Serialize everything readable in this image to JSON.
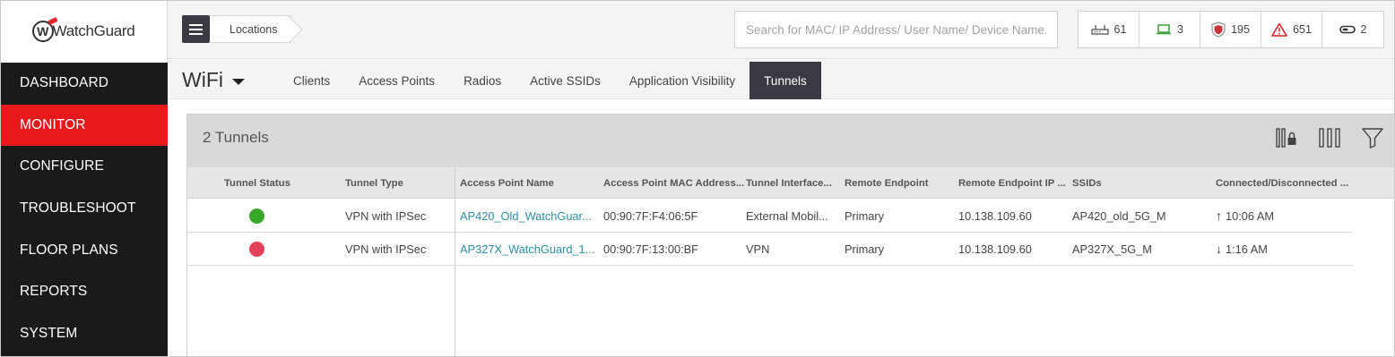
{
  "brand": {
    "logo_text": "WatchGuard"
  },
  "nav": {
    "items": [
      {
        "label": "DASHBOARD"
      },
      {
        "label": "MONITOR"
      },
      {
        "label": "CONFIGURE"
      },
      {
        "label": "TROUBLESHOOT"
      },
      {
        "label": "FLOOR PLANS"
      },
      {
        "label": "REPORTS"
      },
      {
        "label": "SYSTEM"
      }
    ],
    "active": "MONITOR"
  },
  "topbar": {
    "breadcrumb": "Locations",
    "search_placeholder": "Search for MAC/ IP Address/ User Name/ Device Name.",
    "counters": [
      {
        "icon": "access-point-icon",
        "value": "61",
        "color": "#555555"
      },
      {
        "icon": "laptop-icon",
        "value": "3",
        "color": "#3aa035"
      },
      {
        "icon": "shield-icon",
        "value": "195",
        "color": "#c8333a"
      },
      {
        "icon": "warning-triangle-icon",
        "value": "651",
        "color": "#d0201f"
      },
      {
        "icon": "sensor-icon",
        "value": "2",
        "color": "#333333"
      }
    ]
  },
  "section": {
    "title": "WiFi",
    "tabs": [
      {
        "label": "Clients"
      },
      {
        "label": "Access Points"
      },
      {
        "label": "Radios"
      },
      {
        "label": "Active SSIDs"
      },
      {
        "label": "Application Visibility"
      },
      {
        "label": "Tunnels"
      }
    ],
    "active_tab": "Tunnels"
  },
  "panel": {
    "title": "2 Tunnels",
    "tools": [
      "column-lock-icon",
      "columns-icon",
      "filter-icon"
    ]
  },
  "table": {
    "columns": [
      "Tunnel Status",
      "Tunnel Type",
      "Access Point Name",
      "Access Point MAC Address...",
      "Tunnel Interface...",
      "Remote Endpoint",
      "Remote Endpoint IP ...",
      "SSIDs",
      "Connected/Disconnected ..."
    ],
    "rows": [
      {
        "status_color": "#3aa62b",
        "tunnel_type": "VPN with IPSec",
        "ap_name": "AP420_Old_WatchGuar...",
        "ap_mac": "00:90:7F:F4:06:5F",
        "tunnel_interface": "External Mobil...",
        "remote_endpoint": "Primary",
        "remote_ip": "10.138.109.60",
        "ssids": "AP420_old_5G_M",
        "direction": "up",
        "time": "10:06 AM"
      },
      {
        "status_color": "#e0435a",
        "tunnel_type": "VPN with IPSec",
        "ap_name": "AP327X_WatchGuard_1...",
        "ap_mac": "00:90:7F:13:00:BF",
        "tunnel_interface": "VPN",
        "remote_endpoint": "Primary",
        "remote_ip": "10.138.109.60",
        "ssids": "AP327X_5G_M",
        "direction": "down",
        "time": "1:16 AM"
      }
    ]
  }
}
